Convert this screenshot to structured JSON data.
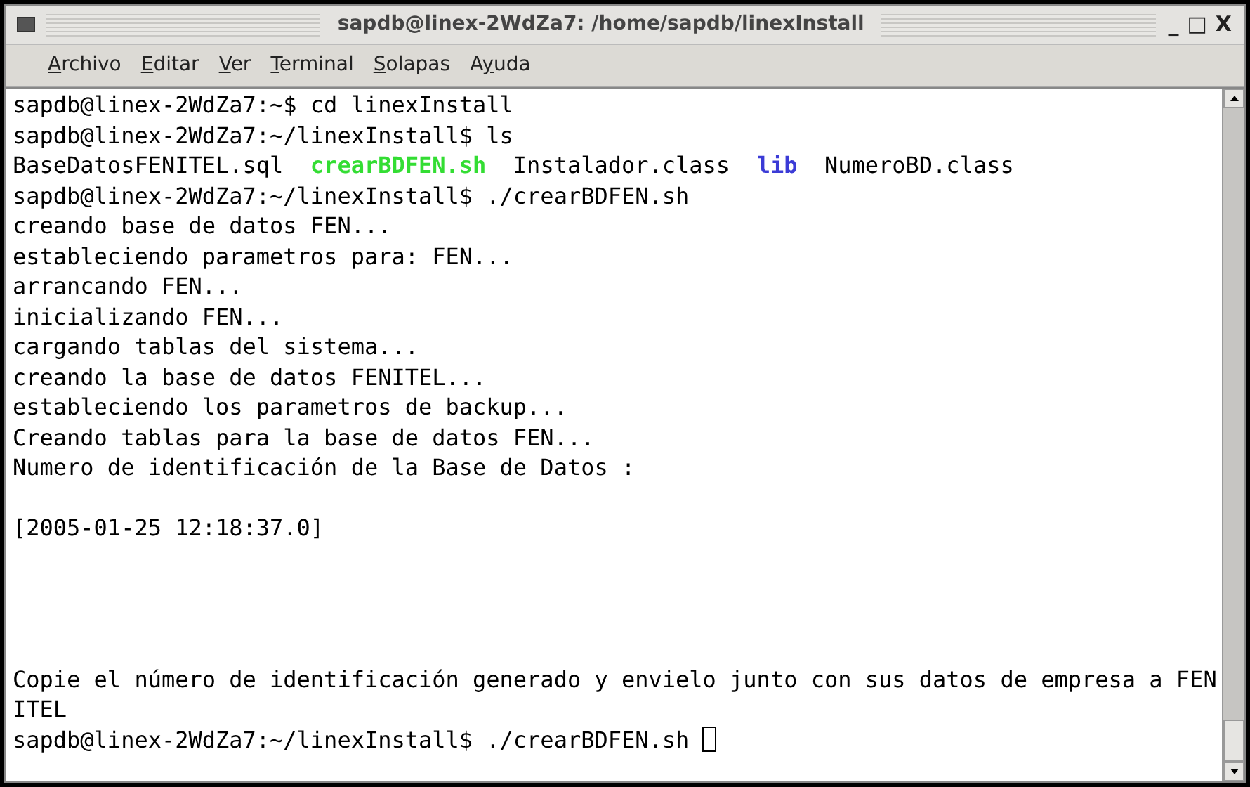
{
  "window": {
    "title": "sapdb@linex-2WdZa7: /home/sapdb/linexInstall",
    "controls": [
      "_",
      "□",
      "X"
    ]
  },
  "menu": [
    {
      "key": "A",
      "after": "rchivo"
    },
    {
      "key": "E",
      "after": "ditar"
    },
    {
      "key": "V",
      "after": "er"
    },
    {
      "key": "T",
      "after": "erminal"
    },
    {
      "key": "S",
      "after": "olapas"
    },
    {
      "before": "A",
      "key": "y",
      "after": "uda"
    }
  ],
  "terminal": {
    "lines": [
      {
        "kind": "text",
        "segments": [
          {
            "text": "sapdb@linex-2WdZa7:~$ cd linexInstall",
            "kind": "plain"
          }
        ]
      },
      {
        "kind": "text",
        "segments": [
          {
            "text": "sapdb@linex-2WdZa7:~/linexInstall$ ls",
            "kind": "plain"
          }
        ]
      },
      {
        "kind": "text",
        "segments": [
          {
            "text": "BaseDatosFENITEL.sql  ",
            "kind": "plain"
          },
          {
            "text": "crearBDFEN.sh",
            "kind": "executable"
          },
          {
            "text": "  Instalador.class  ",
            "kind": "plain"
          },
          {
            "text": "lib",
            "kind": "directory"
          },
          {
            "text": "  NumeroBD.class",
            "kind": "plain"
          }
        ]
      },
      {
        "kind": "text",
        "segments": [
          {
            "text": "sapdb@linex-2WdZa7:~/linexInstall$ ./crearBDFEN.sh",
            "kind": "plain"
          }
        ]
      },
      {
        "kind": "text",
        "segments": [
          {
            "text": "creando base de datos FEN...",
            "kind": "plain"
          }
        ]
      },
      {
        "kind": "text",
        "segments": [
          {
            "text": "estableciendo parametros para: FEN...",
            "kind": "plain"
          }
        ]
      },
      {
        "kind": "text",
        "segments": [
          {
            "text": "arrancando FEN...",
            "kind": "plain"
          }
        ]
      },
      {
        "kind": "text",
        "segments": [
          {
            "text": "inicializando FEN...",
            "kind": "plain"
          }
        ]
      },
      {
        "kind": "text",
        "segments": [
          {
            "text": "cargando tablas del sistema...",
            "kind": "plain"
          }
        ]
      },
      {
        "kind": "text",
        "segments": [
          {
            "text": "creando la base de datos FENITEL...",
            "kind": "plain"
          }
        ]
      },
      {
        "kind": "text",
        "segments": [
          {
            "text": "estableciendo los parametros de backup...",
            "kind": "plain"
          }
        ]
      },
      {
        "kind": "text",
        "segments": [
          {
            "text": "Creando tablas para la base de datos FEN...",
            "kind": "plain"
          }
        ]
      },
      {
        "kind": "text",
        "segments": [
          {
            "text": "Numero de identificación de la Base de Datos :",
            "kind": "plain"
          }
        ]
      },
      {
        "kind": "blank"
      },
      {
        "kind": "text",
        "segments": [
          {
            "text": "[2005-01-25 12:18:37.0]",
            "kind": "plain"
          }
        ]
      },
      {
        "kind": "blank"
      },
      {
        "kind": "blank"
      },
      {
        "kind": "blank"
      },
      {
        "kind": "blank"
      },
      {
        "kind": "text",
        "segments": [
          {
            "text": "Copie el número de identificación generado y envielo junto con sus datos de empresa a FEN",
            "kind": "plain"
          }
        ]
      },
      {
        "kind": "text",
        "segments": [
          {
            "text": "ITEL",
            "kind": "plain"
          }
        ]
      },
      {
        "kind": "prompt",
        "segments": [
          {
            "text": "sapdb@linex-2WdZa7:~/linexInstall$ ./crearBDFEN.sh ",
            "kind": "plain"
          }
        ]
      }
    ]
  }
}
